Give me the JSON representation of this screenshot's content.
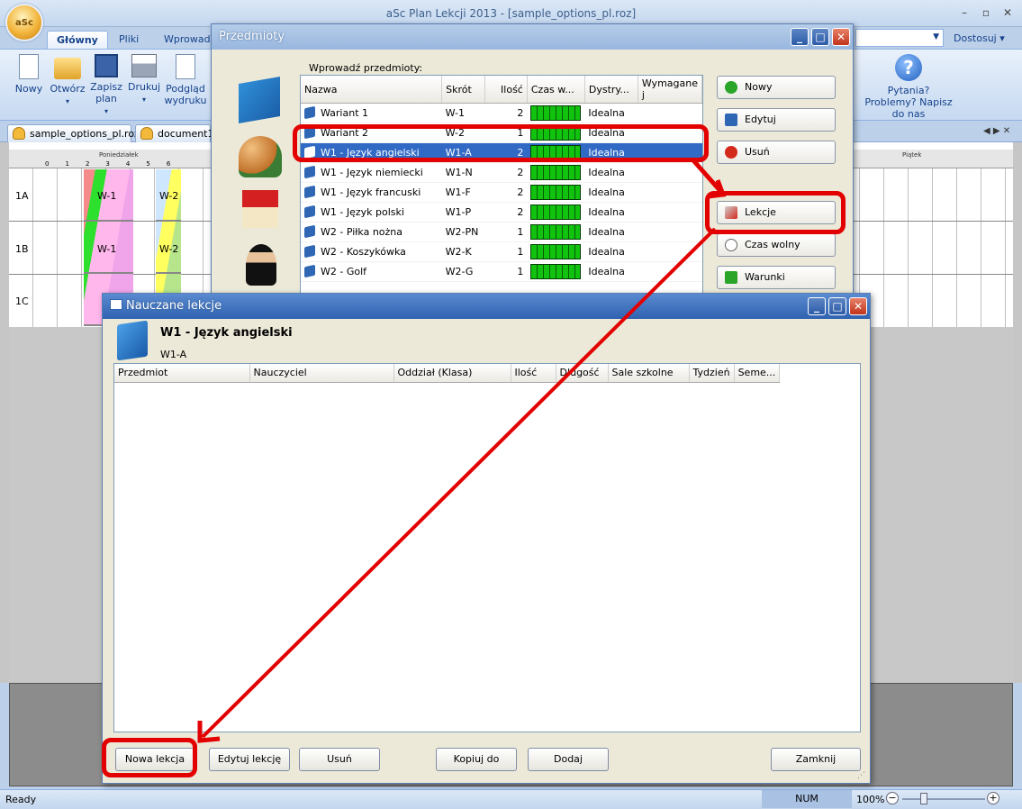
{
  "app": {
    "title": "aSc Plan Lekcji 2013 - [sample_options_pl.roz]",
    "customize": "Dostosuj"
  },
  "ribbon": {
    "tabs": [
      "Główny",
      "Pliki",
      "Wprowad"
    ],
    "buttons": [
      {
        "label": "Nowy",
        "icon": "new-file-icon"
      },
      {
        "label": "Otwórz",
        "icon": "folder-icon"
      },
      {
        "label": "Zapisz plan",
        "icon": "floppy-disk-icon"
      },
      {
        "label": "Drukuj",
        "icon": "printer-icon"
      },
      {
        "label": "Podgląd wydruku",
        "icon": "print-preview-icon"
      }
    ],
    "help": "Pytania? Problemy? Napisz do nas"
  },
  "doc_tabs": [
    "sample_options_pl.roz",
    "document1"
  ],
  "timetable": {
    "days": [
      "Poniedziałek",
      "Piątek"
    ],
    "periods": [
      "0",
      "1",
      "2",
      "3",
      "4",
      "5",
      "6"
    ],
    "classes": [
      "1A",
      "1B",
      "1C"
    ],
    "lessons": [
      "W-1",
      "W-2"
    ]
  },
  "przedmioty": {
    "title": "Przedmioty",
    "prompt": "Wprowadź przedmioty:",
    "columns": [
      "Nazwa",
      "Skrót",
      "Ilość",
      "Czas w...",
      "Dystry...",
      "Wymagane j"
    ],
    "rows": [
      {
        "name": "Wariant 1",
        "short": "W-1",
        "count": "2",
        "dist": "Idealna"
      },
      {
        "name": "Wariant 2",
        "short": "W-2",
        "count": "1",
        "dist": "Idealna"
      },
      {
        "name": "W1 - Język angielski",
        "short": "W1-A",
        "count": "2",
        "dist": "Idealna"
      },
      {
        "name": "W1 - Język niemiecki",
        "short": "W1-N",
        "count": "2",
        "dist": "Idealna"
      },
      {
        "name": "W1 - Język francuski",
        "short": "W1-F",
        "count": "2",
        "dist": "Idealna"
      },
      {
        "name": "W1 - Język polski",
        "short": "W1-P",
        "count": "2",
        "dist": "Idealna"
      },
      {
        "name": "W2 - Piłka nożna",
        "short": "W2-PN",
        "count": "1",
        "dist": "Idealna"
      },
      {
        "name": "W2 - Koszykówka",
        "short": "W2-K",
        "count": "1",
        "dist": "Idealna"
      },
      {
        "name": "W2 - Golf",
        "short": "W2-G",
        "count": "1",
        "dist": "Idealna"
      }
    ],
    "buttons": {
      "new": "Nowy",
      "edit": "Edytuj",
      "delete": "Usuń",
      "lessons": "Lekcje",
      "free_time": "Czas wolny",
      "conditions": "Warunki"
    }
  },
  "nauczane": {
    "title": "Nauczane lekcje",
    "subject": "W1 - Język angielski",
    "short": "W1-A",
    "columns": [
      "Przedmiot",
      "Nauczyciel",
      "Oddział (Klasa)",
      "Ilość",
      "Długość",
      "Sale szkolne",
      "Tydzień",
      "Seme..."
    ],
    "buttons": {
      "new": "Nowa lekcja",
      "edit": "Edytuj lekcję",
      "delete": "Usuń",
      "copy": "Kopiuj do",
      "add": "Dodaj",
      "close": "Zamknij"
    }
  },
  "status": {
    "ready": "Ready",
    "num": "NUM",
    "zoom": "100%"
  },
  "colors": {
    "highlight": "#e30000",
    "selection": "#316ac5",
    "title_blue": "#98b6de"
  }
}
